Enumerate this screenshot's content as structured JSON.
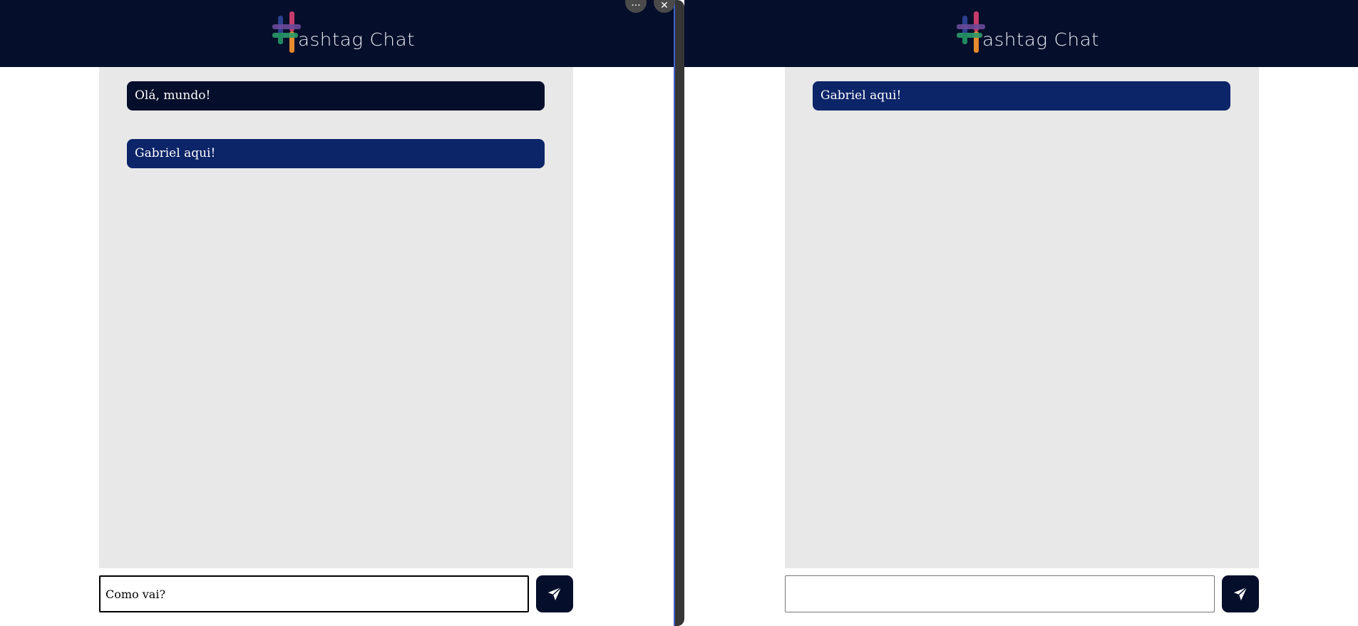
{
  "app": {
    "name": "ashtag Chat"
  },
  "left_pane": {
    "messages": [
      {
        "text": "Olá, mundo!",
        "style": "dark"
      },
      {
        "text": "Gabriel aqui!",
        "style": "blue"
      }
    ],
    "input_value": "Como vai?"
  },
  "right_pane": {
    "messages": [
      {
        "text": "Gabriel aqui!",
        "style": "blue"
      }
    ],
    "input_value": ""
  },
  "window_controls": {
    "more_label": "···",
    "close_label": "✕"
  },
  "icons": {
    "send": "send-icon",
    "logo": "hashtag-logo-icon",
    "more": "more-icon",
    "close": "close-icon"
  },
  "colors": {
    "header_bg": "#050e2a",
    "message_dark": "#050e2a",
    "message_blue": "#0c2468",
    "chat_bg": "#e8e8e8",
    "divider": "#353535"
  }
}
